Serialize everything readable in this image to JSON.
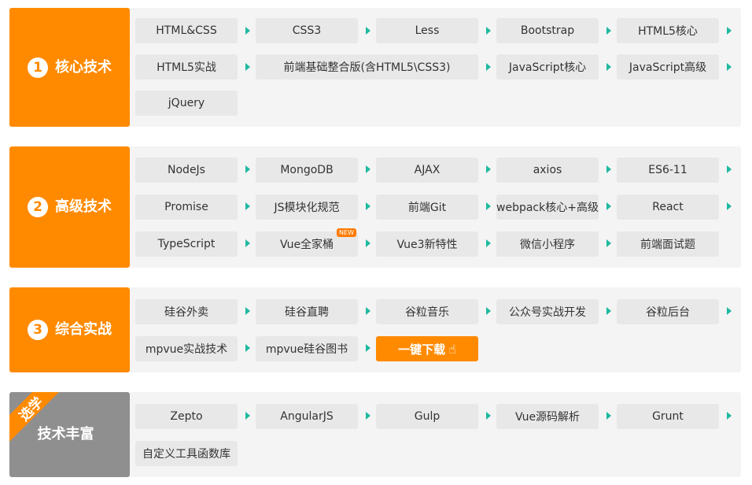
{
  "sections": [
    {
      "num": "1",
      "title": "核心技术",
      "rows": [
        [
          "HTML&CSS",
          "CSS3",
          "Less",
          "Bootstrap",
          "HTML5核心"
        ],
        [
          "HTML5实战",
          "前端基础整合版(含HTML5\\CSS3)",
          "JavaScript核心",
          "JavaScript高级"
        ],
        [
          "jQuery"
        ]
      ]
    },
    {
      "num": "2",
      "title": "高级技术",
      "rows": [
        [
          "NodeJs",
          "MongoDB",
          "AJAX",
          "axios",
          "ES6-11"
        ],
        [
          "Promise",
          "JS模块化规范",
          "前端Git",
          "webpack核心+高级",
          "React"
        ],
        [
          "TypeScript",
          "Vue全家桶",
          "Vue3新特性",
          "微信小程序",
          "前端面试题"
        ]
      ],
      "badge": "NEW"
    },
    {
      "num": "3",
      "title": "综合实战",
      "rows": [
        [
          "硅谷外卖",
          "硅谷直聘",
          "谷粒音乐",
          "公众号实战开发",
          "谷粒后台"
        ],
        [
          "mpvue实战技术",
          "mpvue硅谷图书"
        ]
      ],
      "download_label": "一键下载"
    },
    {
      "ribbon": "选学",
      "title": "技术丰富",
      "rows": [
        [
          "Zepto",
          "AngularJS",
          "Gulp",
          "Vue源码解析",
          "Grunt"
        ],
        [
          "自定义工具函数库"
        ]
      ]
    }
  ],
  "colors": {
    "accent": "#ff8a00",
    "arrow": "#1fb99f",
    "muted": "#8f8f8f"
  },
  "icons": {
    "arrow": "triangle-right-icon",
    "cursor": "hand-pointer-icon"
  }
}
